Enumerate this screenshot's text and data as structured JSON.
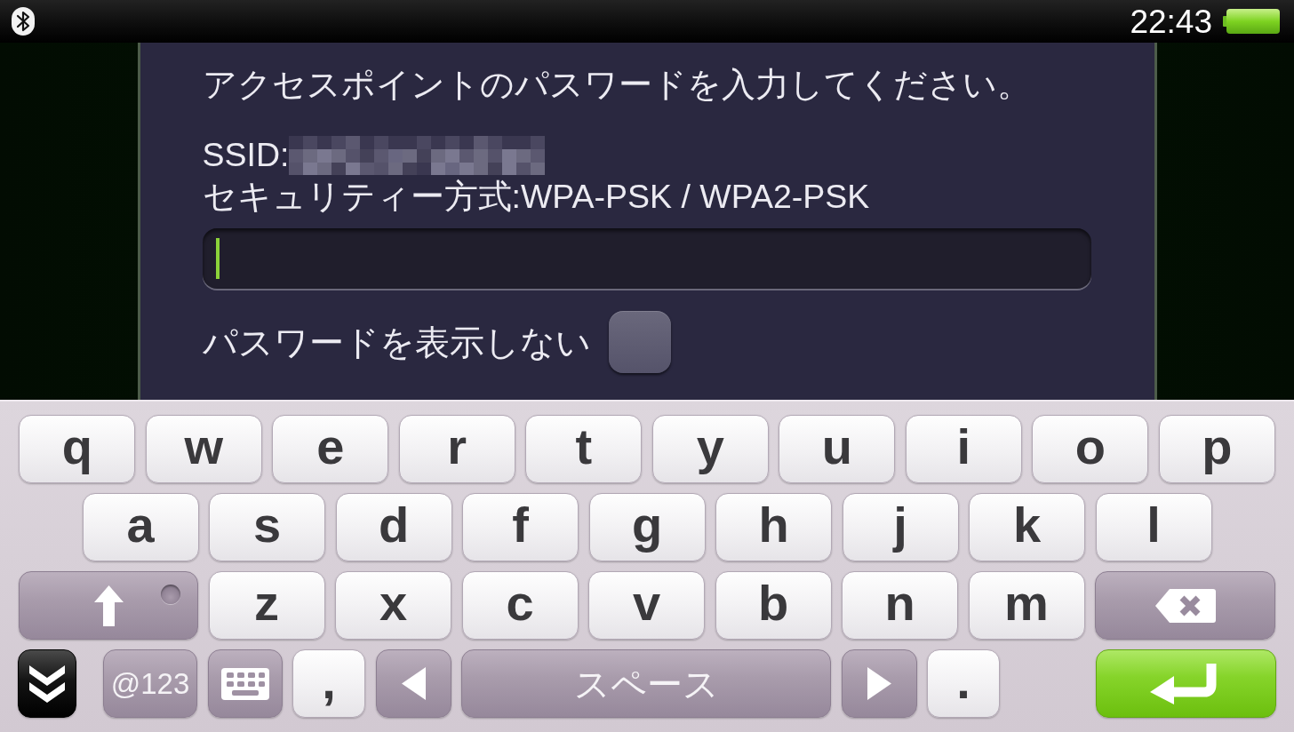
{
  "status_bar": {
    "time": "22:43"
  },
  "dialog": {
    "prompt": "アクセスポイントのパスワードを入力してください。",
    "ssid_label": "SSID:",
    "security": "セキュリティー方式:WPA-PSK / WPA2-PSK",
    "password_field": {
      "focused": true
    },
    "hide_password": {
      "label": "パスワードを表示しない",
      "checked": false
    }
  },
  "keyboard": {
    "rows": [
      [
        {
          "kind": "char",
          "label": "q"
        },
        {
          "kind": "char",
          "label": "w"
        },
        {
          "kind": "char",
          "label": "e"
        },
        {
          "kind": "char",
          "label": "r"
        },
        {
          "kind": "char",
          "label": "t"
        },
        {
          "kind": "char",
          "label": "y"
        },
        {
          "kind": "char",
          "label": "u"
        },
        {
          "kind": "char",
          "label": "i"
        },
        {
          "kind": "char",
          "label": "o"
        },
        {
          "kind": "char",
          "label": "p"
        }
      ],
      [
        {
          "kind": "char",
          "label": "a"
        },
        {
          "kind": "char",
          "label": "s"
        },
        {
          "kind": "char",
          "label": "d"
        },
        {
          "kind": "char",
          "label": "f"
        },
        {
          "kind": "char",
          "label": "g"
        },
        {
          "kind": "char",
          "label": "h"
        },
        {
          "kind": "char",
          "label": "j"
        },
        {
          "kind": "char",
          "label": "k"
        },
        {
          "kind": "char",
          "label": "l"
        }
      ],
      [
        {
          "kind": "shift",
          "caps_lock": false
        },
        {
          "kind": "char",
          "label": "z"
        },
        {
          "kind": "char",
          "label": "x"
        },
        {
          "kind": "char",
          "label": "c"
        },
        {
          "kind": "char",
          "label": "v"
        },
        {
          "kind": "char",
          "label": "b"
        },
        {
          "kind": "char",
          "label": "n"
        },
        {
          "kind": "char",
          "label": "m"
        },
        {
          "kind": "backspace"
        }
      ],
      [
        {
          "kind": "hide"
        },
        {
          "kind": "mode",
          "label": "@123"
        },
        {
          "kind": "layout"
        },
        {
          "kind": "punct",
          "label": ","
        },
        {
          "kind": "left"
        },
        {
          "kind": "space",
          "label": "スペース"
        },
        {
          "kind": "right"
        },
        {
          "kind": "punct",
          "label": "."
        },
        {
          "kind": "enter"
        }
      ]
    ]
  }
}
